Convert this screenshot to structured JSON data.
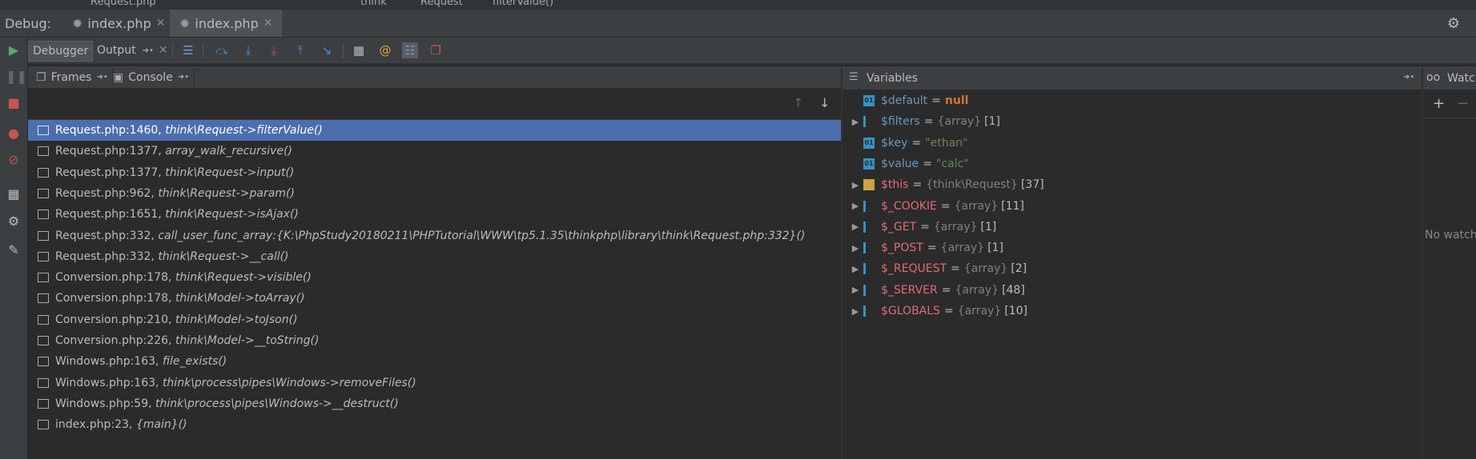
{
  "breadcrumb": {
    "file": "Request.php",
    "path": [
      "think",
      "Request",
      "filterValue()"
    ]
  },
  "debug_bar": {
    "label": "Debug:",
    "tabs": [
      {
        "label": "index.php",
        "active": false
      },
      {
        "label": "index.php",
        "active": true
      }
    ]
  },
  "toolbar": {
    "debugger_tab": "Debugger",
    "output_tab": "Output"
  },
  "frames_pane": {
    "frames_tab": "Frames",
    "console_tab": "Console",
    "frames": [
      {
        "file": "Request.php:1460,",
        "method": "think\\Request->filterValue()",
        "selected": true
      },
      {
        "file": "Request.php:1377,",
        "method": "array_walk_recursive()"
      },
      {
        "file": "Request.php:1377,",
        "method": "think\\Request->input()"
      },
      {
        "file": "Request.php:962,",
        "method": "think\\Request->param()"
      },
      {
        "file": "Request.php:1651,",
        "method": "think\\Request->isAjax()"
      },
      {
        "file": "Request.php:332,",
        "method": "call_user_func_array:{K:\\PhpStudy20180211\\PHPTutorial\\WWW\\tp5.1.35\\thinkphp\\library\\think\\Request.php:332}()"
      },
      {
        "file": "Request.php:332,",
        "method": "think\\Request->__call()"
      },
      {
        "file": "Conversion.php:178,",
        "method": "think\\Request->visible()"
      },
      {
        "file": "Conversion.php:178,",
        "method": "think\\Model->toArray()"
      },
      {
        "file": "Conversion.php:210,",
        "method": "think\\Model->toJson()"
      },
      {
        "file": "Conversion.php:226,",
        "method": "think\\Model->__toString()"
      },
      {
        "file": "Windows.php:163,",
        "method": "file_exists()"
      },
      {
        "file": "Windows.php:163,",
        "method": "think\\process\\pipes\\Windows->removeFiles()"
      },
      {
        "file": "Windows.php:59,",
        "method": "think\\process\\pipes\\Windows->__destruct()"
      },
      {
        "file": "index.php:23,",
        "method": "{main}()"
      }
    ]
  },
  "variables_pane": {
    "title": "Variables",
    "variables": [
      {
        "name": "$default",
        "eq": "=",
        "value": "null",
        "kind": "null",
        "icon": "primitive",
        "expandable": false
      },
      {
        "name": "$filters",
        "eq": "=",
        "type": "{array}",
        "count": "[1]",
        "kind": "array",
        "icon": "array",
        "expandable": true
      },
      {
        "name": "$key",
        "eq": "=",
        "value": "\"ethan\"",
        "kind": "string",
        "icon": "primitive",
        "expandable": false
      },
      {
        "name": "$value",
        "eq": "=",
        "value": "\"calc\"",
        "kind": "string",
        "icon": "primitive",
        "expandable": false
      },
      {
        "name": "$this",
        "eq": "=",
        "type": "{think\\Request}",
        "count": "[37]",
        "kind": "object",
        "icon": "object",
        "expandable": true
      },
      {
        "name": "$_COOKIE",
        "eq": "=",
        "type": "{array}",
        "count": "[11]",
        "kind": "array",
        "icon": "array",
        "expandable": true
      },
      {
        "name": "$_GET",
        "eq": "=",
        "type": "{array}",
        "count": "[1]",
        "kind": "array",
        "icon": "array",
        "expandable": true
      },
      {
        "name": "$_POST",
        "eq": "=",
        "type": "{array}",
        "count": "[1]",
        "kind": "array",
        "icon": "array",
        "expandable": true
      },
      {
        "name": "$_REQUEST",
        "eq": "=",
        "type": "{array}",
        "count": "[2]",
        "kind": "array",
        "icon": "array",
        "expandable": true
      },
      {
        "name": "$_SERVER",
        "eq": "=",
        "type": "{array}",
        "count": "[48]",
        "kind": "array",
        "icon": "array",
        "expandable": true
      },
      {
        "name": "$GLOBALS",
        "eq": "=",
        "type": "{array}",
        "count": "[10]",
        "kind": "array",
        "icon": "array",
        "expandable": true
      }
    ]
  },
  "watches_pane": {
    "title": "Watc",
    "empty_text": "No watch"
  },
  "colors": {
    "selection": "#4b6eaf",
    "resume_green": "#59a869",
    "stop_red": "#c75450"
  }
}
